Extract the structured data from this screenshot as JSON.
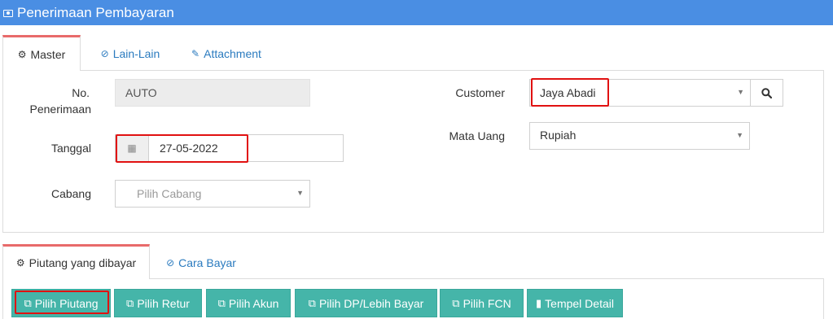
{
  "header": {
    "title": "Penerimaan Pembayaran",
    "icon": "money-icon"
  },
  "master_tabs": [
    {
      "label": "Master",
      "icon": "gears-icon",
      "active": true
    },
    {
      "label": "Lain-Lain",
      "icon": "check-circle-icon",
      "active": false
    },
    {
      "label": "Attachment",
      "icon": "paperclip-icon",
      "active": false
    }
  ],
  "form": {
    "no_penerimaan_label_1": "No.",
    "no_penerimaan_label_2": "Penerimaan",
    "no_penerimaan_value": "AUTO",
    "tanggal_label": "Tanggal",
    "tanggal_value": "27-05-2022",
    "cabang_label": "Cabang",
    "cabang_placeholder": "Pilih Cabang",
    "customer_label": "Customer",
    "customer_value": "Jaya Abadi",
    "mata_uang_label": "Mata Uang",
    "mata_uang_value": "Rupiah"
  },
  "detail_tabs": [
    {
      "label": "Piutang yang dibayar",
      "icon": "gears-icon",
      "active": true
    },
    {
      "label": "Cara Bayar",
      "icon": "check-circle-icon",
      "active": false
    }
  ],
  "buttons": [
    {
      "label": "Pilih Piutang",
      "icon": "copy-icon"
    },
    {
      "label": "Pilih Retur",
      "icon": "copy-icon"
    },
    {
      "label": "Pilih Akun",
      "icon": "copy-icon"
    },
    {
      "label": "Pilih DP/Lebih Bayar",
      "icon": "copy-icon"
    },
    {
      "label": "Pilih FCN",
      "icon": "copy-icon"
    },
    {
      "label": "Tempel Detail",
      "icon": "paste-icon"
    }
  ],
  "colors": {
    "header_bg": "#4a8ee3",
    "accent_tab": "#e86a6a",
    "button_bg": "#45b5a9",
    "highlight": "#e11111",
    "link": "#2b7bbf"
  }
}
